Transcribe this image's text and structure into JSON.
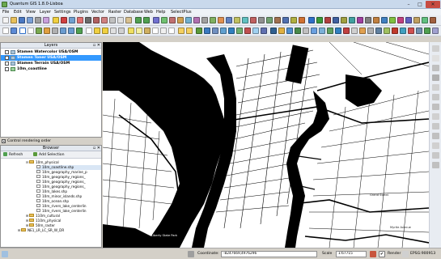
{
  "window": {
    "title": "Quantum GIS 1.8.0-Lisboa",
    "minimize": "–",
    "maximize": "□",
    "close": "✕"
  },
  "menus": [
    "File",
    "Edit",
    "View",
    "Layer",
    "Settings",
    "Plugins",
    "Vector",
    "Raster",
    "Database",
    "Web",
    "Help",
    "SelectPlus"
  ],
  "layers_panel": {
    "title": "Layers",
    "items": [
      {
        "name": "Stamen Watercolor USA/OSM",
        "checked": false,
        "selected": false
      },
      {
        "name": "Stamen Toner USA/OSM",
        "checked": true,
        "selected": true
      },
      {
        "name": "Stamen Terrain USA/OSM",
        "checked": false,
        "selected": false
      },
      {
        "name": "10m_coastline",
        "checked": false,
        "selected": false
      }
    ]
  },
  "render_order": {
    "label": "Control rendering order",
    "check": "✕"
  },
  "browser_panel": {
    "title": "Browser",
    "refresh_label": "Refresh",
    "add_selection_label": "Add Selection",
    "tree": [
      {
        "label": "10m_physical",
        "level": 1,
        "type": "folder",
        "toggle": "⊟"
      },
      {
        "label": "10m_coastline.shp",
        "level": 2,
        "type": "file",
        "toggle": "",
        "selected": true
      },
      {
        "label": "10m_geography_marine_p",
        "level": 2,
        "type": "file",
        "toggle": ""
      },
      {
        "label": "10m_geography_regions_",
        "level": 2,
        "type": "file",
        "toggle": ""
      },
      {
        "label": "10m_geography_regions_",
        "level": 2,
        "type": "file",
        "toggle": ""
      },
      {
        "label": "10m_geography_regions_",
        "level": 2,
        "type": "file",
        "toggle": ""
      },
      {
        "label": "10m_lakes.shp",
        "level": 2,
        "type": "file",
        "toggle": ""
      },
      {
        "label": "10m_minor_islands.shp",
        "level": 2,
        "type": "file",
        "toggle": ""
      },
      {
        "label": "10m_ocean.shp",
        "level": 2,
        "type": "file",
        "toggle": ""
      },
      {
        "label": "10m_rivers_lake_centerlin",
        "level": 2,
        "type": "file",
        "toggle": ""
      },
      {
        "label": "10m_rivers_lake_centerlin",
        "level": 2,
        "type": "file",
        "toggle": ""
      },
      {
        "label": "110m_cultural",
        "level": 1,
        "type": "folder",
        "toggle": "⊞"
      },
      {
        "label": "110m_physical",
        "level": 1,
        "type": "folder",
        "toggle": "⊞"
      },
      {
        "label": "50m_raster",
        "level": 1,
        "type": "folder",
        "toggle": "⊞"
      },
      {
        "label": "NE1_LR_LC_SR_W_DR",
        "level": 0,
        "type": "folder",
        "toggle": "⊞"
      }
    ]
  },
  "map": {
    "street_labels": [
      "Myrtle Avenue",
      "Grand Street",
      "Liberty State Park"
    ]
  },
  "statusbar": {
    "coordinate_label": "Coordinate:",
    "coordinate_value": "-8247669,4976296",
    "scale_label": "Scale",
    "scale_value": "1:67715",
    "render_label": "Render",
    "render_check": "✔",
    "crs_label": "EPSG:900913"
  },
  "colors": {
    "selection": "#3399ff",
    "water": "#000000",
    "land": "#ffffff"
  }
}
